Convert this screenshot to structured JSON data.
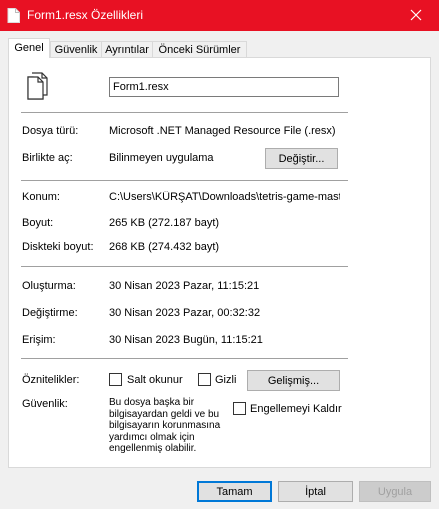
{
  "window": {
    "title": "Form1.resx Özellikleri",
    "title_icon": "file-icon",
    "close_icon": "close-icon",
    "titlebar_color": "#e81123"
  },
  "tabs": [
    {
      "label": "Genel",
      "active": true
    },
    {
      "label": "Güvenlik",
      "active": false
    },
    {
      "label": "Ayrıntılar",
      "active": false
    },
    {
      "label": "Önceki Sürümler",
      "active": false
    }
  ],
  "general": {
    "file_icon": "document-icon",
    "filename": "Form1.resx",
    "file_type_label": "Dosya türü:",
    "file_type_value": "Microsoft .NET Managed Resource File (.resx)",
    "opens_with_label": "Birlikte aç:",
    "opens_with_value": "Bilinmeyen uygulama",
    "change_button": "Değiştir...",
    "location_label": "Konum:",
    "location_value": "C:\\Users\\KÜRŞAT\\Downloads\\tetris-game-master",
    "size_label": "Boyut:",
    "size_value": "265 KB (272.187 bayt)",
    "size_on_disk_label": "Diskteki boyut:",
    "size_on_disk_value": "268 KB (274.432 bayt)",
    "created_label": "Oluşturma:",
    "created_value": "30 Nisan 2023 Pazar, 11:15:21",
    "modified_label": "Değiştirme:",
    "modified_value": "30 Nisan 2023 Pazar, 00:32:32",
    "accessed_label": "Erişim:",
    "accessed_value": "30 Nisan 2023 Bugün, 11:15:21",
    "attributes_label": "Öznitelikler:",
    "readonly_label": "Salt okunur",
    "readonly_checked": false,
    "hidden_label": "Gizli",
    "hidden_checked": false,
    "advanced_button": "Gelişmiş...",
    "security_label": "Güvenlik:",
    "security_lines": [
      "Bu dosya başka bir",
      "bilgisayardan geldi ve bu",
      "bilgisayarın korunmasına",
      "yardımcı olmak için",
      "engellenmiş olabilir."
    ],
    "unblock_label": "Engellemeyi Kaldır",
    "unblock_checked": false
  },
  "footer": {
    "ok": "Tamam",
    "cancel": "İptal",
    "apply": "Uygula"
  }
}
